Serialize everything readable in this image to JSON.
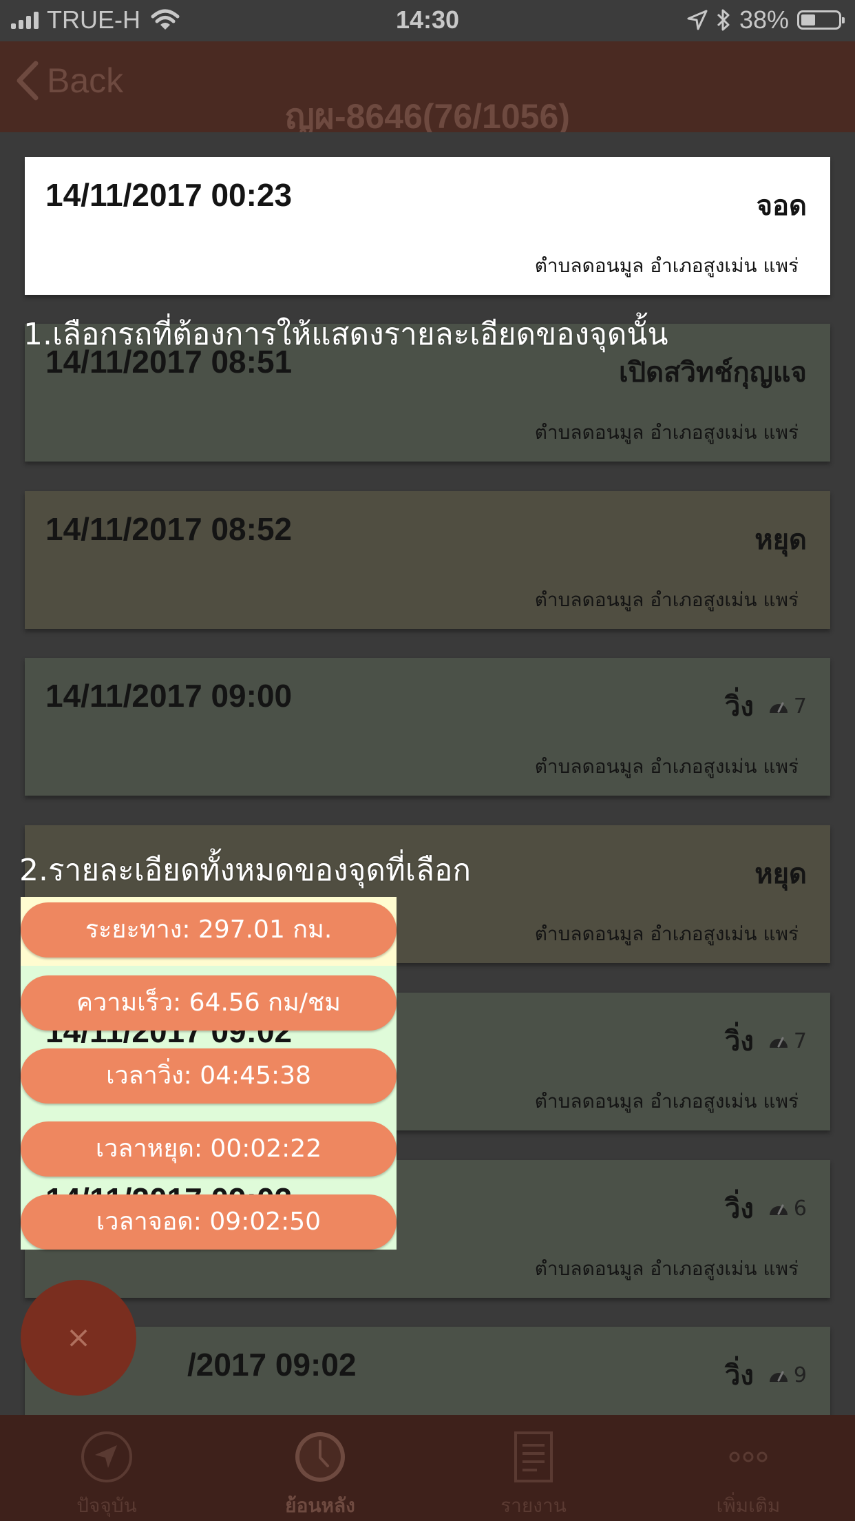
{
  "status_bar": {
    "carrier": "TRUE-H",
    "time": "14:30",
    "battery": "38%",
    "battery_level": 0.38,
    "icons": [
      "signal-icon",
      "wifi-icon",
      "location-arrow-icon",
      "bluetooth-icon",
      "battery-icon"
    ]
  },
  "nav": {
    "back_label": "Back",
    "title": "ญผ-8646(76/1056)"
  },
  "entries": [
    {
      "datetime": "14/11/2017 00:23",
      "status": "จอด",
      "location": "ตำบลดอนมูล อำเภอสูงเม่น แพร่",
      "speed": "",
      "color": "#ffffff",
      "selected": true
    },
    {
      "datetime": "14/11/2017 08:51",
      "status": "เปิดสวิทช์กุญแจ",
      "location": "ตำบลดอนมูล อำเภอสูงเม่น แพร่",
      "speed": "",
      "color": "#4b5148"
    },
    {
      "datetime": "14/11/2017 08:52",
      "status": "หยุด",
      "location": "ตำบลดอนมูล อำเภอสูงเม่น แพร่",
      "speed": "",
      "color": "#504e41"
    },
    {
      "datetime": "14/11/2017 09:00",
      "status": "วิ่ง",
      "location": "ตำบลดอนมูล อำเภอสูงเม่น แพร่",
      "speed": "7",
      "color": "#4b5148"
    },
    {
      "datetime": "",
      "status": "หยุด",
      "location": "ตำบลดอนมูล อำเภอสูงเม่น แพร่",
      "speed": "",
      "color": "#504e41"
    },
    {
      "datetime": "",
      "status": "วิ่ง",
      "location": "ตำบลดอนมูล อำเภอสูงเม่น แพร่",
      "speed": "7",
      "color": "#4b5148"
    },
    {
      "datetime": "",
      "status": "วิ่ง",
      "location": "ตำบลดอนมูล อำเภอสูงเม่น แพร่",
      "speed": "6",
      "color": "#4b5148"
    },
    {
      "datetime": "/2017 09:02",
      "status": "วิ่ง",
      "location": "",
      "speed": "9",
      "color": "#4b5148"
    }
  ],
  "annotations": {
    "step1": "1.เลือกรถที่ต้องการให้แสดงรายละเอียดของจุดนั้น",
    "step2": "2.รายละเอียดทั้งหมดของจุดที่เลือก"
  },
  "details_popup": {
    "ghost_line_1": "14/11/2017 09:02",
    "ghost_line_2": "14/11/2017 09:02",
    "items": [
      "ระยะทาง: 297.01 กม.",
      "ความเร็ว: 64.56 กม/ชม",
      "เวลาวิ่ง: 04:45:38",
      "เวลาหยุด: 00:02:22",
      "เวลาจอด: 09:02:50"
    ]
  },
  "fab": {
    "icon": "close-icon",
    "glyph": "×"
  },
  "tabs": [
    {
      "label": "ปัจจุบัน",
      "icon": "navigation-icon",
      "active": false
    },
    {
      "label": "ย้อนหลัง",
      "icon": "clock-icon",
      "active": true
    },
    {
      "label": "รายงาน",
      "icon": "report-icon",
      "active": false
    },
    {
      "label": "เพิ่มเติม",
      "icon": "more-icon",
      "active": false
    }
  ],
  "colors": {
    "pill": "#ee8760",
    "popup_bg": "#dffbd9",
    "nav_bg": "#4a2a22",
    "fab": "#7a2e1f"
  }
}
